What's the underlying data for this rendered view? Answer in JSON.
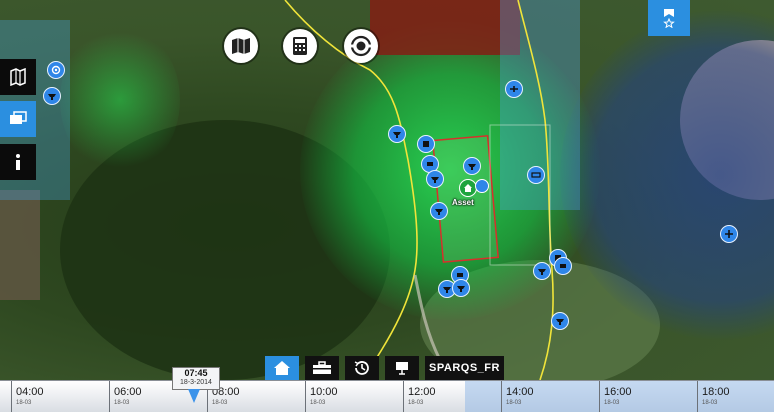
{
  "colors": {
    "accent": "#2b8fe0",
    "coverage_green": "#18d24a",
    "coverage_blue": "#1f3b6e",
    "coverage_red": "#7a1d14",
    "asset_outline": "#d7302b",
    "road": "#f0e43a"
  },
  "left_toolbar": [
    {
      "icon": "map-layers-icon"
    },
    {
      "icon": "windows-icon",
      "active": true
    },
    {
      "icon": "info-icon"
    }
  ],
  "top_tools": [
    {
      "icon": "map-fold-icon"
    },
    {
      "icon": "calculator-icon"
    },
    {
      "icon": "target-radar-icon"
    }
  ],
  "top_right": {
    "icon": "bookmark-star-icon"
  },
  "asset": {
    "label": "Asset",
    "icon": "home-icon"
  },
  "markers": [
    "radar-icon",
    "camera-icon",
    "camera-icon",
    "sensor-icon",
    "sensor-icon",
    "camera-icon",
    "aircraft-icon",
    "camera-icon",
    "sensor-icon",
    "camera-icon",
    "camera-icon",
    "aircraft-icon",
    "camera-icon",
    "camera-icon",
    "sensor-icon",
    "sensor-icon",
    "camera-icon",
    "camera-icon",
    "aircraft-icon"
  ],
  "bottom_toolbar": {
    "home": {
      "icon": "home-icon",
      "active": true
    },
    "toolbox": {
      "icon": "toolbox-icon"
    },
    "history": {
      "icon": "history-icon"
    },
    "presentation": {
      "icon": "presentation-icon"
    },
    "scenario_label": "SPARQS_FR"
  },
  "timeline": {
    "current_time": "07:45",
    "current_date": "18-3-2014",
    "ticks": [
      {
        "time": "04:00",
        "date": "18-03"
      },
      {
        "time": "06:00",
        "date": "18-03"
      },
      {
        "time": "08:00",
        "date": "18-03"
      },
      {
        "time": "10:00",
        "date": "18-03"
      },
      {
        "time": "12:00",
        "date": "18-03"
      },
      {
        "time": "14:00",
        "date": "18-03"
      },
      {
        "time": "16:00",
        "date": "18-03"
      },
      {
        "time": "18:00",
        "date": "18-03"
      }
    ]
  }
}
